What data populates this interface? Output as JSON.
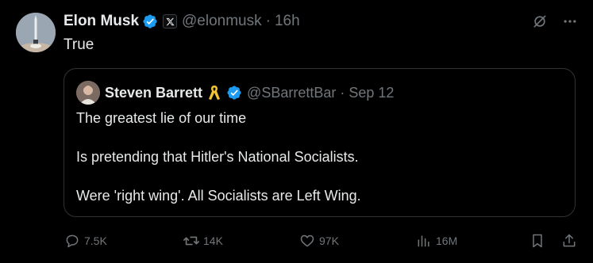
{
  "post": {
    "author_name": "Elon Musk",
    "handle": "@elonmusk",
    "separator": "·",
    "time": "16h",
    "text": "True"
  },
  "quoted": {
    "author_name": "Steven Barrett",
    "handle": "@SBarrettBar",
    "separator": "·",
    "date": "Sep 12",
    "paragraphs": [
      "The greatest lie of our time",
      "Is pretending that Hitler's National Socialists.",
      "Were 'right wing'. All Socialists are Left Wing."
    ]
  },
  "actions": {
    "replies": "7.5K",
    "reposts": "14K",
    "likes": "97K",
    "views": "16M"
  },
  "icons": {
    "verified": "verified-badge-icon",
    "x_badge": "x-logo-icon",
    "grok": "grok-icon",
    "more": "more-icon",
    "ribbon": "yellow-ribbon-icon",
    "reply": "reply-icon",
    "repost": "repost-icon",
    "like": "heart-icon",
    "views": "views-icon",
    "bookmark": "bookmark-icon",
    "share": "share-icon"
  },
  "colors": {
    "background": "#000000",
    "text": "#e7e9ea",
    "muted": "#71767b",
    "verified": "#1d9bf0",
    "border": "#2f3336",
    "ribbon": "#f4c430"
  }
}
